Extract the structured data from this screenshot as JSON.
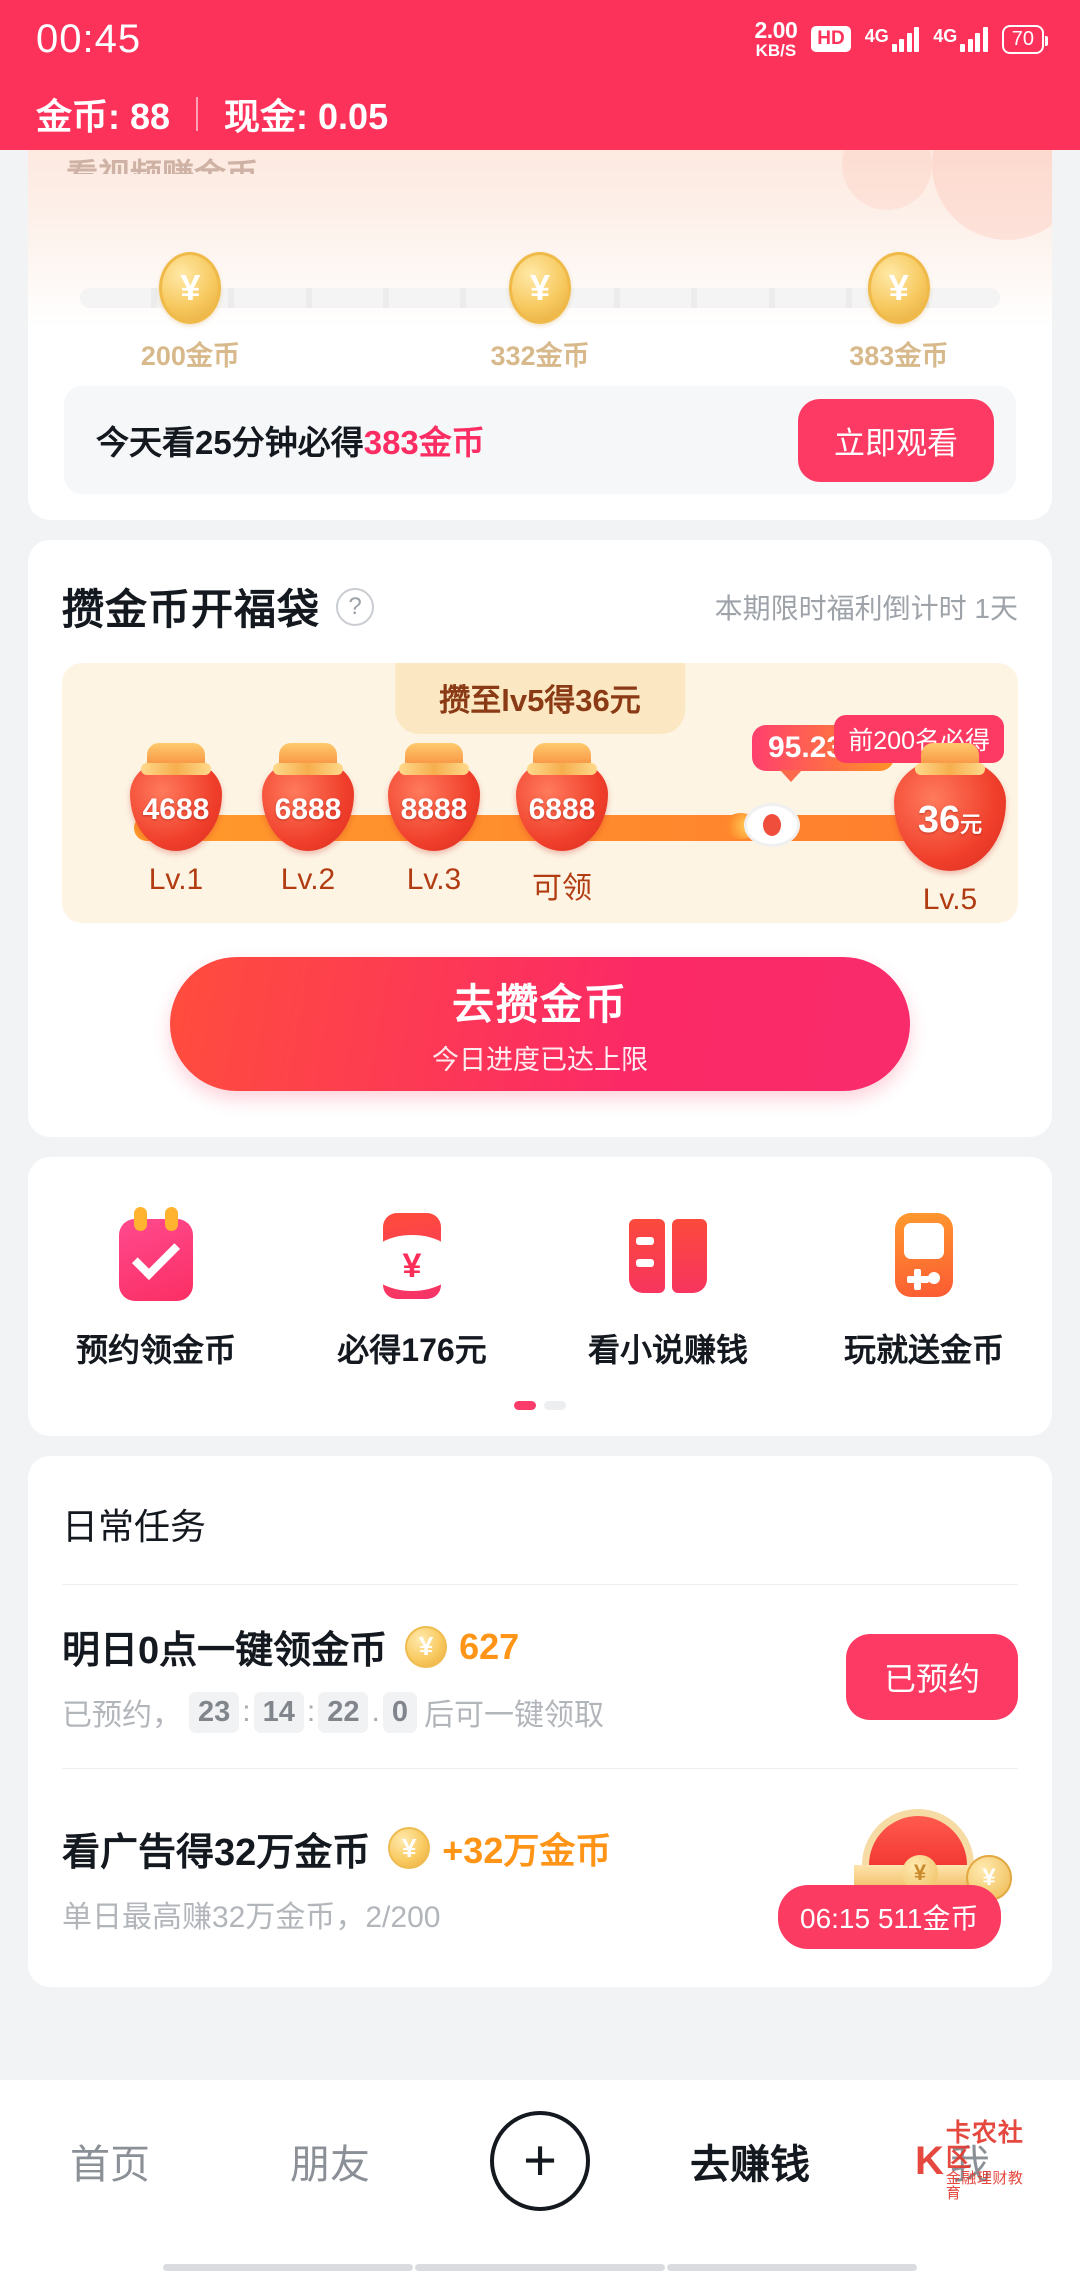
{
  "status_bar": {
    "time": "00:45",
    "net_speed_value": "2.00",
    "net_speed_unit": "KB/S",
    "hd_badge": "HD",
    "sim1_network": "4G",
    "sim2_network": "4G",
    "battery": "70"
  },
  "app_header": {
    "coins_label": "金币: 88",
    "cash_label": "现金: 0.05"
  },
  "watch_card": {
    "clipped_title": "看视频赚金币",
    "milestones": [
      {
        "coin_symbol": "¥",
        "label": "200金币"
      },
      {
        "coin_symbol": "¥",
        "label": "332金币"
      },
      {
        "coin_symbol": "¥",
        "label": "383金币"
      }
    ],
    "promo_prefix": "今天看25分钟必得",
    "promo_highlight": "383金币",
    "watch_button": "立即观看"
  },
  "lucky_bag": {
    "title": "攒金币开福袋",
    "help_icon": "?",
    "countdown": "本期限时福利倒计时 1天",
    "ribbon": "攒至lv5得36元",
    "percent_badge": "95.23 %",
    "top_badge": "前200名必得",
    "levels": [
      {
        "value": "4688",
        "unit": "",
        "label": "Lv.1"
      },
      {
        "value": "6888",
        "unit": "",
        "label": "Lv.2"
      },
      {
        "value": "8888",
        "unit": "",
        "label": "Lv.3"
      },
      {
        "value": "6888",
        "unit": "",
        "label": "可领"
      },
      {
        "value": "36",
        "unit": "元",
        "label": "Lv.5"
      }
    ],
    "cta_primary": "去攒金币",
    "cta_secondary": "今日进度已达上限"
  },
  "shortcuts": {
    "items": [
      {
        "icon": "calendar-check-icon",
        "label": "预约领金币"
      },
      {
        "icon": "red-envelope-icon",
        "label": "必得176元"
      },
      {
        "icon": "book-icon",
        "label": "看小说赚钱"
      },
      {
        "icon": "game-console-icon",
        "label": "玩就送金币"
      }
    ],
    "page_dots": 2,
    "active_dot": 0
  },
  "daily_tasks": {
    "title": "日常任务",
    "tasks": [
      {
        "name": "明日0点一键领金币",
        "coin_symbol": "¥",
        "reward": "627",
        "sub_prefix": "已预约，",
        "countdown_hours": "23",
        "countdown_minutes": "14",
        "countdown_seconds": "22",
        "countdown_tenths": "0",
        "sub_suffix": "后可一键领取",
        "action_label": "已预约"
      },
      {
        "name": "看广告得32万金币",
        "coin_symbol": "¥",
        "reward": "+32万金币",
        "sub_text": "单日最高赚32万金币，2/200",
        "chest_badge": "06:15 511金币"
      }
    ]
  },
  "bottom_nav": {
    "items": [
      {
        "label": "首页",
        "active": false
      },
      {
        "label": "朋友",
        "active": false
      },
      {
        "label": "+",
        "active": false
      },
      {
        "label": "去赚钱",
        "active": true
      },
      {
        "label": "我",
        "active": false
      }
    ],
    "watermark_k": "K",
    "watermark_top": "卡农社区",
    "watermark_bottom": "金融理财教育"
  },
  "colors": {
    "brand": "#fc325b",
    "accent": "#ff9416",
    "coin_gold": "#f7c95f",
    "bag_red": "#f0402c"
  }
}
